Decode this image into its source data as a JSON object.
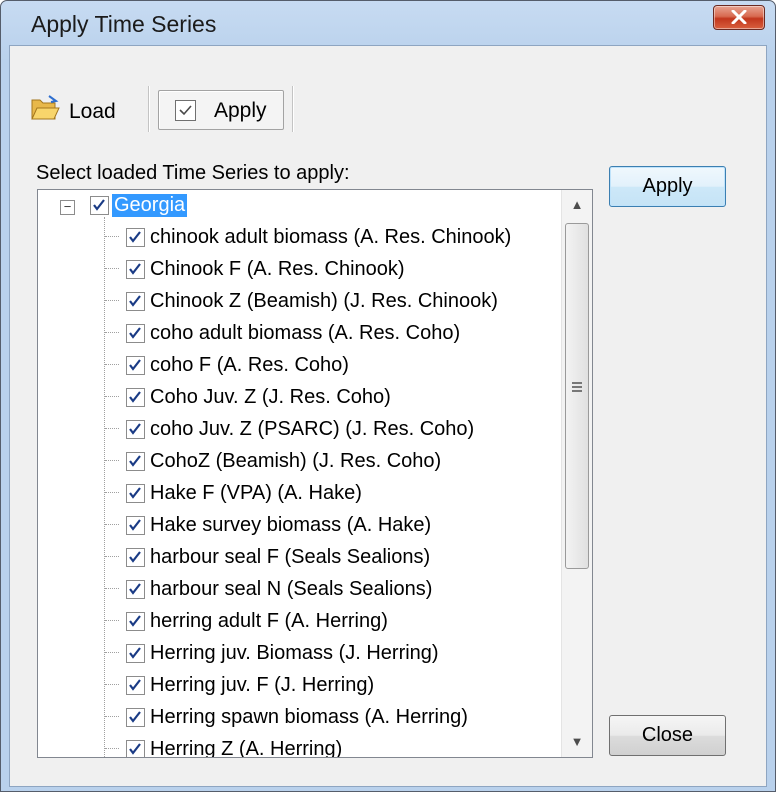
{
  "window": {
    "title": "Apply Time Series"
  },
  "toolbar": {
    "load_label": "Load",
    "apply_label": "Apply"
  },
  "section_label": "Select loaded Time Series to apply:",
  "tree": {
    "root": {
      "label": "Georgia",
      "checked": true,
      "expanded": true,
      "selected": true
    },
    "items": [
      {
        "label": "chinook adult biomass (A. Res. Chinook)",
        "checked": true
      },
      {
        "label": "Chinook F (A. Res. Chinook)",
        "checked": true
      },
      {
        "label": "Chinook Z (Beamish) (J. Res. Chinook)",
        "checked": true
      },
      {
        "label": "coho adult biomass (A. Res. Coho)",
        "checked": true
      },
      {
        "label": "coho F (A. Res. Coho)",
        "checked": true
      },
      {
        "label": "Coho Juv. Z (J. Res. Coho)",
        "checked": true
      },
      {
        "label": "coho Juv. Z (PSARC) (J. Res. Coho)",
        "checked": true
      },
      {
        "label": "CohoZ (Beamish) (J. Res. Coho)",
        "checked": true
      },
      {
        "label": "Hake F (VPA) (A. Hake)",
        "checked": true
      },
      {
        "label": "Hake survey biomass (A. Hake)",
        "checked": true
      },
      {
        "label": "harbour seal F (Seals Sealions)",
        "checked": true
      },
      {
        "label": "harbour seal N (Seals Sealions)",
        "checked": true
      },
      {
        "label": "herring adult F (A. Herring)",
        "checked": true
      },
      {
        "label": "Herring juv. Biomass (J. Herring)",
        "checked": true
      },
      {
        "label": "Herring juv. F (J. Herring)",
        "checked": true
      },
      {
        "label": "Herring spawn biomass (A. Herring)",
        "checked": true
      },
      {
        "label": "Herring Z (A. Herring)",
        "checked": true
      }
    ]
  },
  "buttons": {
    "apply_label": "Apply",
    "close_label": "Close"
  },
  "colors": {
    "selection": "#3399ff",
    "check": "#1a3b85"
  }
}
